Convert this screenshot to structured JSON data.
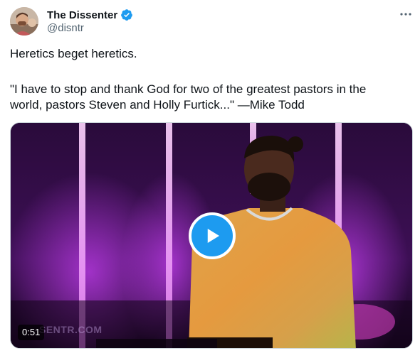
{
  "author": {
    "display_name": "The Dissenter",
    "handle": "@disntr",
    "verified": true
  },
  "tweet": {
    "line1": "Heretics beget heretics.",
    "line2": "\"I have to stop and thank God for two of the greatest pastors in the",
    "line3": "world, pastors Steven and Holly Furtick...\" —Mike Todd"
  },
  "media": {
    "type": "video",
    "duration": "0:51",
    "watermark": "SENTR.COM"
  },
  "icons": {
    "verified": "verified-badge-icon",
    "more": "more-options-icon",
    "play": "play-icon"
  },
  "colors": {
    "accent": "#1d9bf0",
    "text": "#0f1419",
    "secondary_text": "#536471",
    "border": "#cfd9de"
  }
}
